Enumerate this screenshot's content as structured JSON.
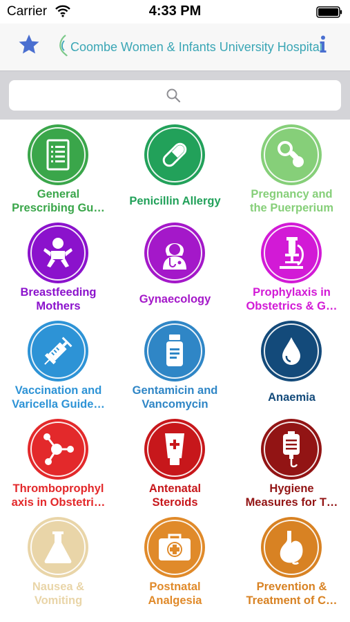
{
  "status_bar": {
    "carrier": "Carrier",
    "time": "4:33 PM"
  },
  "nav": {
    "title": "Coombe Women & Infants University Hospital",
    "accent": "#3aa6b5",
    "star_color": "#4a6fd0"
  },
  "search": {
    "placeholder": ""
  },
  "tiles": [
    {
      "label": "General\nPrescribing Gu…",
      "color": "#3aa64a",
      "icon": "document-icon"
    },
    {
      "label": "Penicillin Allergy",
      "color": "#22a15a",
      "icon": "pill-icon"
    },
    {
      "label": "Pregnancy and\nthe Puerperium",
      "color": "#86cf79",
      "icon": "pacifier-icon"
    },
    {
      "label": "Breastfeeding\nMothers",
      "color": "#8b12cc",
      "icon": "baby-icon"
    },
    {
      "label": "Gynaecology",
      "color": "#a418c9",
      "icon": "doctor-icon"
    },
    {
      "label": "Prophylaxis in\nObstetrics & G…",
      "color": "#d21ad6",
      "icon": "microscope-icon"
    },
    {
      "label": "Vaccination and\nVaricella Guide…",
      "color": "#2d93d6",
      "icon": "syringe-icon"
    },
    {
      "label": "Gentamicin and\nVancomycin",
      "color": "#2f86c6",
      "icon": "medicine-bottle-icon"
    },
    {
      "label": "Anaemia",
      "color": "#134a7a",
      "icon": "drop-icon"
    },
    {
      "label": "Thromboprophyl\naxis in Obstetri…",
      "color": "#e3292b",
      "icon": "molecule-icon"
    },
    {
      "label": "Antenatal\nSteroids",
      "color": "#c7171b",
      "icon": "cream-tube-icon"
    },
    {
      "label": "Hygiene\nMeasures for T…",
      "color": "#921414",
      "icon": "iv-bag-icon"
    },
    {
      "label": "Nausea &\nVomiting",
      "color": "#e9d5a8",
      "icon": "flask-icon"
    },
    {
      "label": "Postnatal\nAnalgesia",
      "color": "#e08a2a",
      "icon": "first-aid-kit-icon"
    },
    {
      "label": "Prevention &\nTreatment of C…",
      "color": "#d88223",
      "icon": "stomach-icon"
    }
  ]
}
